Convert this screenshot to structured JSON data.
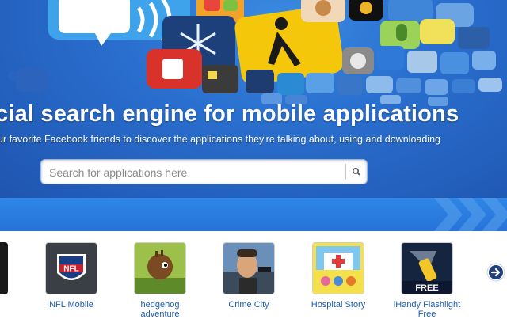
{
  "hero": {
    "headline": "cial search engine for mobile applications",
    "subline": "ur favorite Facebook friends to discover the applications they're talking about, using and downloading"
  },
  "search": {
    "placeholder": "Search for applications here",
    "button_icon": "search-icon"
  },
  "apps": [
    {
      "name": "NFL Mobile",
      "name2": "",
      "badge": ""
    },
    {
      "name": "hedgehog",
      "name2": "adventure",
      "badge": ""
    },
    {
      "name": "Crime City",
      "name2": "",
      "badge": ""
    },
    {
      "name": "Hospital Story",
      "name2": "",
      "badge": ""
    },
    {
      "name": "iHandy Flashlight",
      "name2": "Free",
      "badge": "FREE"
    }
  ],
  "nfl_logo_text": "NFL",
  "carousel": {
    "next_icon": "arrow-right-icon"
  },
  "colors": {
    "hero_blue": "#2a6fcf",
    "band_blue": "#2f86e6",
    "link_blue": "#1f5dab"
  }
}
